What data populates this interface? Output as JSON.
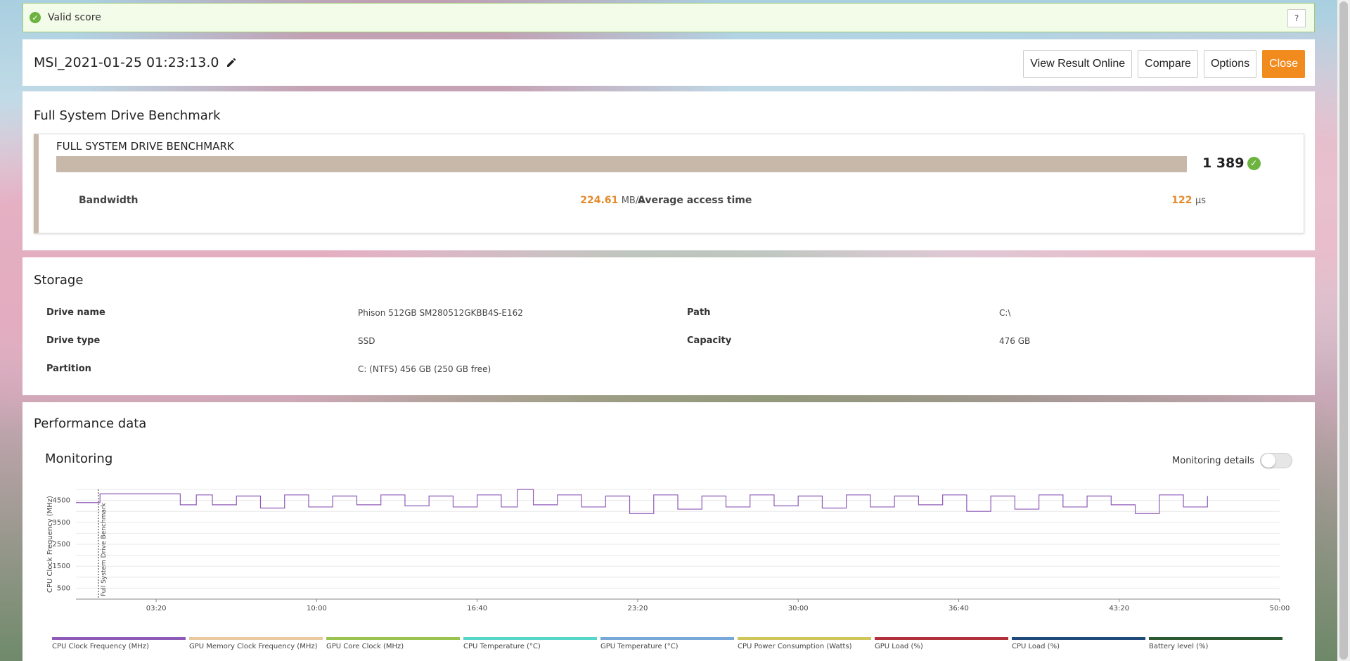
{
  "valid_banner": {
    "text": "Valid score",
    "help": "?"
  },
  "header": {
    "result_name": "MSI_2021-01-25 01:23:13.0",
    "buttons": {
      "view_online": "View Result Online",
      "compare": "Compare",
      "options": "Options",
      "close": "Close"
    }
  },
  "benchmark": {
    "section_title": "Full System Drive Benchmark",
    "card_title": "FULL SYSTEM DRIVE BENCHMARK",
    "score": "1 389",
    "bandwidth_label": "Bandwidth",
    "bandwidth_value": "224.61",
    "bandwidth_unit": "MB/s",
    "access_label": "Average access time",
    "access_value": "122",
    "access_unit": "μs",
    "bar_color": "#c7b8aa"
  },
  "storage": {
    "section_title": "Storage",
    "drive_name_label": "Drive name",
    "drive_name": "Phison 512GB SM280512GKBB4S-E162",
    "drive_type_label": "Drive type",
    "drive_type": "SSD",
    "partition_label": "Partition",
    "partition": "C: (NTFS) 456 GB (250 GB free)",
    "path_label": "Path",
    "path": "C:\\",
    "capacity_label": "Capacity",
    "capacity": "476 GB"
  },
  "performance": {
    "section_title": "Performance data",
    "monitoring_title": "Monitoring",
    "monitoring_details_label": "Monitoring details",
    "monitoring_details_on": false
  },
  "chart_data": {
    "type": "line",
    "ylabel": "CPU Clock Frequency (MHz)",
    "annotation": "Full System Drive Benchmark",
    "y_ticks": [
      500,
      1500,
      2500,
      3500,
      4500
    ],
    "ylim": [
      0,
      5000
    ],
    "x_ticks": [
      "03:20",
      "10:00",
      "16:40",
      "23:20",
      "30:00",
      "36:40",
      "43:20",
      "50:00"
    ],
    "xlim_seconds": [
      0,
      3000
    ],
    "series": [
      {
        "name": "CPU Clock Frequency (MHz)",
        "color": "#8e5bb8",
        "x_seconds": [
          0,
          60,
          120,
          180,
          220,
          260,
          300,
          340,
          400,
          460,
          520,
          580,
          640,
          700,
          760,
          820,
          880,
          940,
          1000,
          1060,
          1100,
          1140,
          1200,
          1260,
          1320,
          1380,
          1440,
          1500,
          1560,
          1620,
          1680,
          1740,
          1800,
          1860,
          1920,
          1980,
          2040,
          2100,
          2160,
          2220,
          2280,
          2340,
          2400,
          2460,
          2520,
          2580,
          2640,
          2700,
          2760,
          2820
        ],
        "values": [
          4400,
          4800,
          4800,
          4800,
          4800,
          4300,
          4750,
          4300,
          4700,
          4150,
          4750,
          4200,
          4700,
          4300,
          4750,
          4250,
          4700,
          4200,
          4750,
          4200,
          5000,
          4300,
          4750,
          4200,
          4700,
          3900,
          4750,
          4100,
          4700,
          4200,
          4750,
          4250,
          4700,
          4150,
          4750,
          4200,
          4700,
          4300,
          4750,
          4000,
          4700,
          4100,
          4750,
          4200,
          4700,
          4300,
          3900,
          4750,
          4200,
          4700
        ]
      }
    ]
  },
  "legend": [
    {
      "label": "CPU Clock Frequency (MHz)",
      "color": "#8e5bb8"
    },
    {
      "label": "GPU Memory Clock Frequency (MHz)",
      "color": "#e8c9a0"
    },
    {
      "label": "GPU Core Clock (MHz)",
      "color": "#9ac24e"
    },
    {
      "label": "CPU Temperature (°C)",
      "color": "#55d6c8"
    },
    {
      "label": "GPU Temperature (°C)",
      "color": "#78a8d8"
    },
    {
      "label": "CPU Power Consumption (Watts)",
      "color": "#cfc55a"
    },
    {
      "label": "GPU Load (%)",
      "color": "#b0303c"
    },
    {
      "label": "CPU Load (%)",
      "color": "#1f4a7a"
    },
    {
      "label": "Battery level (%)",
      "color": "#2b5a33"
    }
  ]
}
